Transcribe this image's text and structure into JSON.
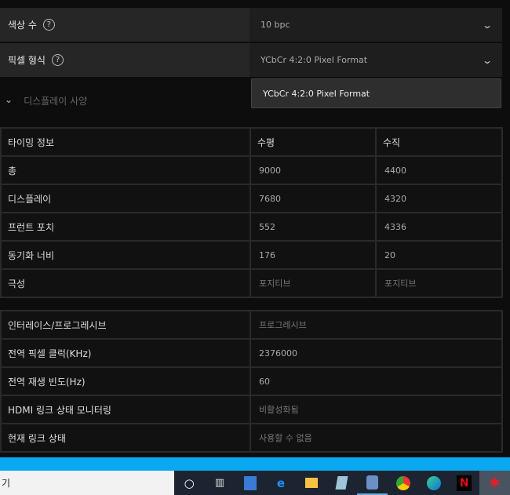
{
  "settings": [
    {
      "label": "색상 수",
      "value": "10 bpc"
    },
    {
      "label": "픽셀 형식",
      "value": "YCbCr 4:2:0 Pixel Format"
    }
  ],
  "dropdown_option": "YCbCr 4:2:0 Pixel Format",
  "section": {
    "label": "디스플레이 사양"
  },
  "timing_table": {
    "headers": [
      "타이밍 정보",
      "수평",
      "수직"
    ],
    "rows": [
      [
        "총",
        "9000",
        "4400"
      ],
      [
        "디스플레이",
        "7680",
        "4320"
      ],
      [
        "프런트 포치",
        "552",
        "4336"
      ],
      [
        "동기화 너비",
        "176",
        "20"
      ],
      [
        "극성",
        "포지티브",
        "포지티브"
      ]
    ]
  },
  "info_table": [
    [
      "인터레이스/프로그레시브",
      "프로그레시브"
    ],
    [
      "전역 픽셀 클럭(KHz)",
      "2376000"
    ],
    [
      "전역 재생 빈도(Hz)",
      "60"
    ],
    [
      "HDMI 링크 상태 모니터링",
      "비활성화됨"
    ],
    [
      "현재 링크 상태",
      "사용할 수 없음"
    ]
  ],
  "taskbar": {
    "search_text": "기",
    "icons": [
      "cortana-icon",
      "task-view-icon",
      "app-icon",
      "edge-legacy-icon",
      "file-explorer-icon",
      "notepad-icon",
      "app2-icon",
      "chrome-icon",
      "edge-icon",
      "netflix-icon",
      "amd-radeon-icon"
    ]
  }
}
